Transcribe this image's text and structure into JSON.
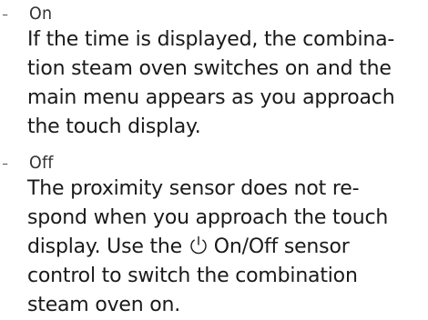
{
  "options": [
    {
      "bullet": "-",
      "label": "On",
      "lines": [
        "If the time is displayed, the combina-",
        "tion steam oven switches on and the",
        "main menu appears as you approach",
        "the touch display."
      ]
    },
    {
      "bullet": "-",
      "label": "Off",
      "lines": [
        "The proximity sensor does not re-",
        "spond when you approach the touch",
        "display. Use the",
        "On/Off sensor",
        "control to switch the combination",
        "steam oven on."
      ]
    }
  ],
  "icons": {
    "power": "power-icon"
  },
  "colors": {
    "text": "#1a1a1a",
    "option_label": "#333333",
    "background": "#ffffff"
  }
}
